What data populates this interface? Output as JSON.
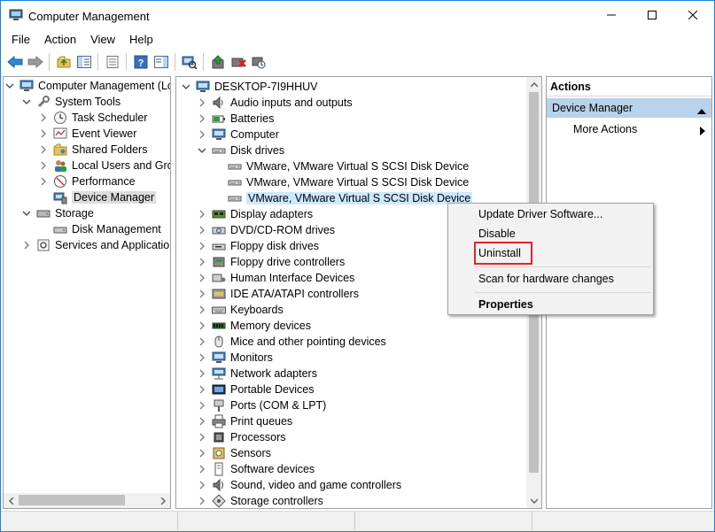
{
  "window": {
    "title": "Computer Management"
  },
  "menu": [
    "File",
    "Action",
    "View",
    "Help"
  ],
  "toolbar": [
    "back-icon",
    "forward-icon",
    "up-folder-icon",
    "show-hide-tree-icon",
    "properties-icon",
    "help-icon",
    "show-action-pane-icon",
    "scan-hardware-icon",
    "update-driver-icon",
    "uninstall-device-icon",
    "disable-device-icon"
  ],
  "left_tree": [
    {
      "label": "Computer Management (Local",
      "icon": "computer-management-icon",
      "level": 0,
      "expander": "down"
    },
    {
      "label": "System Tools",
      "icon": "system-tools-icon",
      "level": 1,
      "expander": "down"
    },
    {
      "label": "Task Scheduler",
      "icon": "clock-icon",
      "level": 2,
      "expander": "right"
    },
    {
      "label": "Event Viewer",
      "icon": "event-viewer-icon",
      "level": 2,
      "expander": "right"
    },
    {
      "label": "Shared Folders",
      "icon": "shared-folders-icon",
      "level": 2,
      "expander": "right"
    },
    {
      "label": "Local Users and Groups",
      "icon": "users-icon",
      "level": 2,
      "expander": "right"
    },
    {
      "label": "Performance",
      "icon": "performance-icon",
      "level": 2,
      "expander": "right"
    },
    {
      "label": "Device Manager",
      "icon": "device-manager-icon",
      "level": 2,
      "expander": "",
      "selected": true
    },
    {
      "label": "Storage",
      "icon": "storage-icon",
      "level": 1,
      "expander": "down"
    },
    {
      "label": "Disk Management",
      "icon": "disk-management-icon",
      "level": 2,
      "expander": ""
    },
    {
      "label": "Services and Applications",
      "icon": "services-icon",
      "level": 1,
      "expander": "right"
    }
  ],
  "device_tree": {
    "root": "DESKTOP-7I9HHUV",
    "items": [
      {
        "label": "Audio inputs and outputs",
        "icon": "audio-icon",
        "expander": "right"
      },
      {
        "label": "Batteries",
        "icon": "battery-icon",
        "expander": "right"
      },
      {
        "label": "Computer",
        "icon": "monitor-icon",
        "expander": "right"
      },
      {
        "label": "Disk drives",
        "icon": "disk-drive-icon",
        "expander": "down"
      },
      {
        "label": "VMware, VMware Virtual S SCSI Disk Device",
        "icon": "disk-drive-icon",
        "expander": "",
        "child": true
      },
      {
        "label": "VMware, VMware Virtual S SCSI Disk Device",
        "icon": "disk-drive-icon",
        "expander": "",
        "child": true
      },
      {
        "label": "VMware, VMware Virtual S SCSI Disk Device",
        "icon": "disk-drive-icon",
        "expander": "",
        "child": true,
        "selected": true
      },
      {
        "label": "Display adapters",
        "icon": "display-adapter-icon",
        "expander": "right"
      },
      {
        "label": "DVD/CD-ROM drives",
        "icon": "dvd-icon",
        "expander": "right"
      },
      {
        "label": "Floppy disk drives",
        "icon": "floppy-icon",
        "expander": "right"
      },
      {
        "label": "Floppy drive controllers",
        "icon": "floppy-controller-icon",
        "expander": "right"
      },
      {
        "label": "Human Interface Devices",
        "icon": "hid-icon",
        "expander": "right"
      },
      {
        "label": "IDE ATA/ATAPI controllers",
        "icon": "ide-icon",
        "expander": "right"
      },
      {
        "label": "Keyboards",
        "icon": "keyboard-icon",
        "expander": "right"
      },
      {
        "label": "Memory devices",
        "icon": "memory-icon",
        "expander": "right"
      },
      {
        "label": "Mice and other pointing devices",
        "icon": "mouse-icon",
        "expander": "right"
      },
      {
        "label": "Monitors",
        "icon": "monitor-icon",
        "expander": "right"
      },
      {
        "label": "Network adapters",
        "icon": "network-icon",
        "expander": "right"
      },
      {
        "label": "Portable Devices",
        "icon": "portable-device-icon",
        "expander": "right"
      },
      {
        "label": "Ports (COM & LPT)",
        "icon": "ports-icon",
        "expander": "right"
      },
      {
        "label": "Print queues",
        "icon": "printer-icon",
        "expander": "right"
      },
      {
        "label": "Processors",
        "icon": "processor-icon",
        "expander": "right"
      },
      {
        "label": "Sensors",
        "icon": "sensor-icon",
        "expander": "right"
      },
      {
        "label": "Software devices",
        "icon": "software-device-icon",
        "expander": "right"
      },
      {
        "label": "Sound, video and game controllers",
        "icon": "speaker-icon",
        "expander": "right"
      },
      {
        "label": "Storage controllers",
        "icon": "storage-controller-icon",
        "expander": "right"
      }
    ]
  },
  "actions": {
    "header": "Actions",
    "section": "Device Manager",
    "more": "More Actions"
  },
  "context_menu": {
    "update": "Update Driver Software...",
    "disable": "Disable",
    "uninstall": "Uninstall",
    "scan": "Scan for hardware changes",
    "properties": "Properties"
  },
  "colors": {
    "selection": "#cce8ff",
    "actions_section": "#b9d1ea",
    "highlight_box": "#e0242b",
    "window_border": "#1883d7"
  }
}
